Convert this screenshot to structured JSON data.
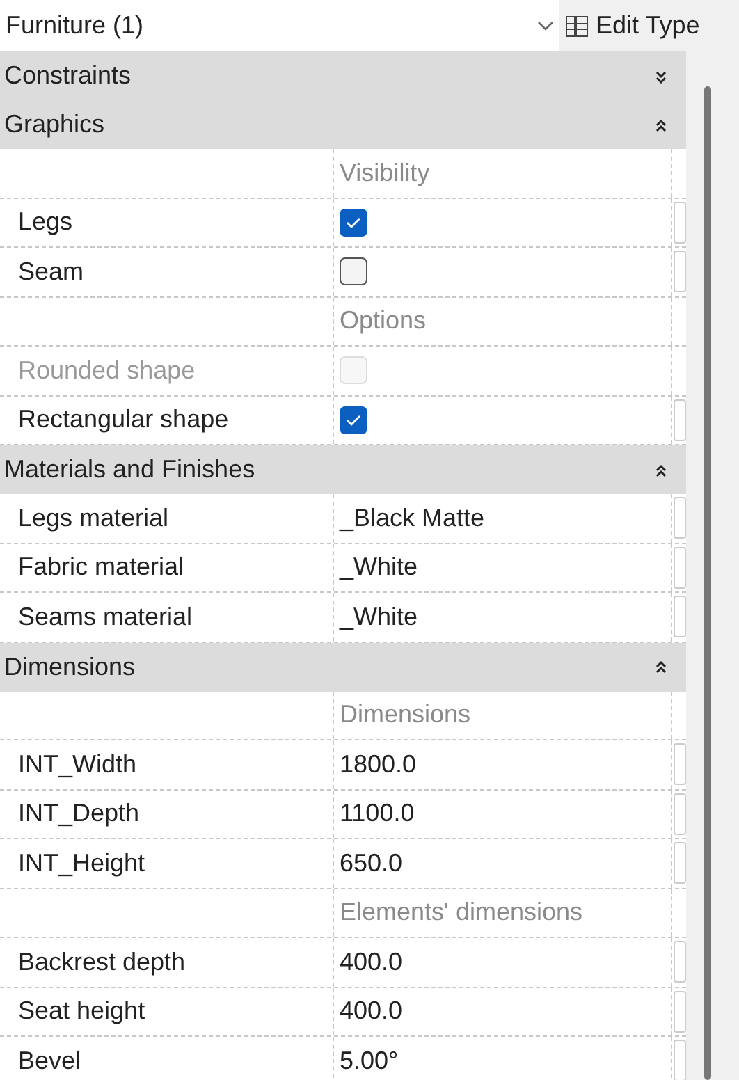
{
  "type_selector": {
    "value": "Furniture (1)"
  },
  "edit_type_button": {
    "label": "Edit Type"
  },
  "sections": [
    {
      "title": "Constraints",
      "expanded": false
    },
    {
      "title": "Graphics",
      "expanded": true,
      "rows": [
        {
          "kind": "group",
          "label": "Visibility"
        },
        {
          "kind": "checkbox",
          "name": "Legs",
          "checked": true,
          "disabled": false
        },
        {
          "kind": "checkbox",
          "name": "Seam",
          "checked": false,
          "disabled": false
        },
        {
          "kind": "group",
          "label": "Options"
        },
        {
          "kind": "checkbox",
          "name": "Rounded shape",
          "checked": false,
          "disabled": true
        },
        {
          "kind": "checkbox",
          "name": "Rectangular shape",
          "checked": true,
          "disabled": false
        }
      ]
    },
    {
      "title": "Materials and Finishes",
      "expanded": true,
      "rows": [
        {
          "kind": "text",
          "name": "Legs material",
          "value": "_Black Matte"
        },
        {
          "kind": "text",
          "name": "Fabric material",
          "value": "_White"
        },
        {
          "kind": "text",
          "name": "Seams material",
          "value": "_White"
        }
      ]
    },
    {
      "title": "Dimensions",
      "expanded": true,
      "rows": [
        {
          "kind": "group",
          "label": "Dimensions"
        },
        {
          "kind": "text",
          "name": "INT_Width",
          "value": "1800.0"
        },
        {
          "kind": "text",
          "name": "INT_Depth",
          "value": "1100.0"
        },
        {
          "kind": "text",
          "name": "INT_Height",
          "value": "650.0"
        },
        {
          "kind": "group",
          "label": "Elements' dimensions"
        },
        {
          "kind": "text",
          "name": "Backrest depth",
          "value": "400.0"
        },
        {
          "kind": "text",
          "name": "Seat height",
          "value": "400.0"
        },
        {
          "kind": "text",
          "name": "Bevel",
          "value": "5.00°"
        }
      ]
    }
  ]
}
